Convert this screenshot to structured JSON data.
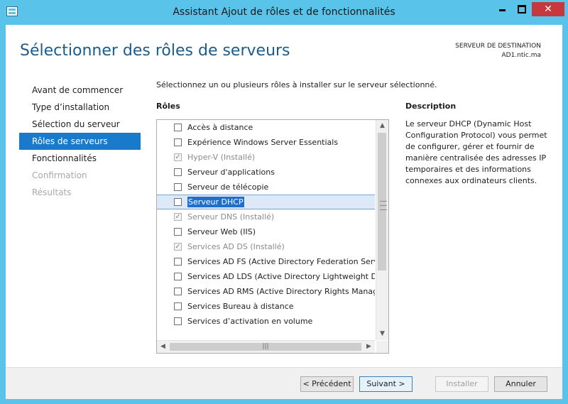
{
  "window": {
    "title": "Assistant Ajout de rôles et de fonctionnalités",
    "close_label": "✕"
  },
  "header": {
    "page_title": "Sélectionner des rôles de serveurs",
    "dest_label": "SERVEUR DE DESTINATION",
    "dest_server": "AD1.ntic.ma"
  },
  "nav": {
    "items": [
      {
        "label": "Avant de commencer",
        "state": "normal"
      },
      {
        "label": "Type d’installation",
        "state": "normal"
      },
      {
        "label": "Sélection du serveur",
        "state": "normal"
      },
      {
        "label": "Rôles de serveurs",
        "state": "active"
      },
      {
        "label": "Fonctionnalités",
        "state": "normal"
      },
      {
        "label": "Confirmation",
        "state": "disabled"
      },
      {
        "label": "Résultats",
        "state": "disabled"
      }
    ]
  },
  "main": {
    "intro": "Sélectionnez un ou plusieurs rôles à installer sur le serveur sélectionné.",
    "roles_label": "Rôles",
    "roles": [
      {
        "label": "Accès à distance",
        "checked": false,
        "disabled": false,
        "selected": false
      },
      {
        "label": "Expérience Windows Server Essentials",
        "checked": false,
        "disabled": false,
        "selected": false
      },
      {
        "label": "Hyper-V (Installé)",
        "checked": true,
        "disabled": true,
        "selected": false
      },
      {
        "label": "Serveur d'applications",
        "checked": false,
        "disabled": false,
        "selected": false
      },
      {
        "label": "Serveur de télécopie",
        "checked": false,
        "disabled": false,
        "selected": false
      },
      {
        "label": "Serveur DHCP",
        "checked": false,
        "disabled": false,
        "selected": true
      },
      {
        "label": "Serveur DNS (Installé)",
        "checked": true,
        "disabled": true,
        "selected": false
      },
      {
        "label": "Serveur Web (IIS)",
        "checked": false,
        "disabled": false,
        "selected": false
      },
      {
        "label": "Services AD DS (Installé)",
        "checked": true,
        "disabled": true,
        "selected": false
      },
      {
        "label": "Services AD FS (Active Directory Federation Servic",
        "checked": false,
        "disabled": false,
        "selected": false
      },
      {
        "label": "Services AD LDS (Active Directory Lightweight Dire",
        "checked": false,
        "disabled": false,
        "selected": false
      },
      {
        "label": "Services AD RMS (Active Directory Rights Manage",
        "checked": false,
        "disabled": false,
        "selected": false
      },
      {
        "label": "Services Bureau à distance",
        "checked": false,
        "disabled": false,
        "selected": false
      },
      {
        "label": "Services d’activation en volume",
        "checked": false,
        "disabled": false,
        "selected": false
      }
    ],
    "description_label": "Description",
    "description_text": "Le serveur DHCP (Dynamic Host Configuration Protocol) vous permet de configurer, gérer et fournir de manière centralisée des adresses IP temporaires et des informations connexes aux ordinateurs clients."
  },
  "footer": {
    "prev": "< Précédent",
    "next": "Suivant >",
    "install": "Installer",
    "cancel": "Annuler"
  },
  "colors": {
    "title_bar": "#59c3ea",
    "accent": "#1979ca",
    "page_title": "#1b5c8a",
    "close": "#c7383e"
  }
}
